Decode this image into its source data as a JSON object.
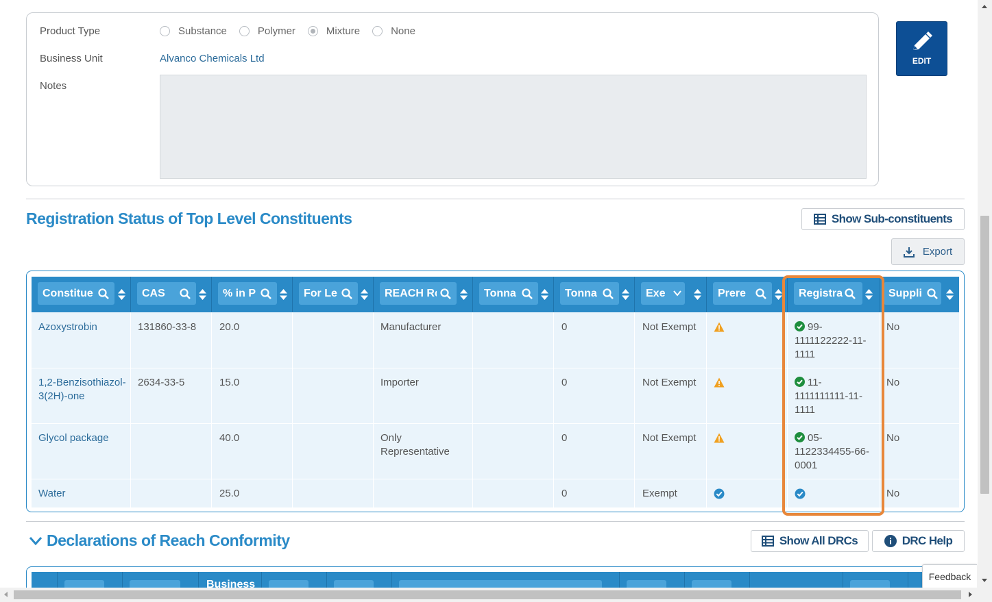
{
  "form": {
    "product_type_label": "Product Type",
    "product_type_options": [
      {
        "label": "Substance",
        "checked": false
      },
      {
        "label": "Polymer",
        "checked": false
      },
      {
        "label": "Mixture",
        "checked": true
      },
      {
        "label": "None",
        "checked": false
      }
    ],
    "business_unit_label": "Business Unit",
    "business_unit_value": "Alvanco Chemicals Ltd",
    "notes_label": "Notes",
    "notes_value": ""
  },
  "edit_button": {
    "label": "EDIT",
    "icon": "pencil-icon"
  },
  "registration_section": {
    "title": "Registration Status of Top Level Constituents",
    "show_sub_label": "Show Sub-constituents",
    "export_label": "Export"
  },
  "table": {
    "headers": [
      "Constitue",
      "CAS",
      "% in P",
      "For Le",
      "REACH Rc",
      "Tonna",
      "Tonna",
      "Exe",
      "Prere",
      "Registra",
      "Suppli"
    ],
    "rows": [
      {
        "constituent": "Azoxystrobin",
        "cas": "131860-33-8",
        "percent": "20.0",
        "for_legal": "",
        "reach_role": "Manufacturer",
        "tonnage1": "",
        "tonnage2": "0",
        "exemption": "Not Exempt",
        "prereg": "warning",
        "registration": "99-1111122222-11-1111",
        "registration_status": "ok",
        "supplier": "No"
      },
      {
        "constituent": "1,2-Benzisothiazol-3(2H)-one",
        "cas": "2634-33-5",
        "percent": "15.0",
        "for_legal": "",
        "reach_role": "Importer",
        "tonnage1": "",
        "tonnage2": "0",
        "exemption": "Not Exempt",
        "prereg": "warning",
        "registration": "11-1111111111-11-1111",
        "registration_status": "ok",
        "supplier": "No"
      },
      {
        "constituent": "Glycol package",
        "cas": "",
        "percent": "40.0",
        "for_legal": "",
        "reach_role": "Only Representative",
        "tonnage1": "",
        "tonnage2": "0",
        "exemption": "Not Exempt",
        "prereg": "warning",
        "registration": "05-1122334455-66-0001",
        "registration_status": "ok",
        "supplier": "No"
      },
      {
        "constituent": "Water",
        "cas": "",
        "percent": "25.0",
        "for_legal": "",
        "reach_role": "",
        "tonnage1": "",
        "tonnage2": "0",
        "exemption": "Exempt",
        "prereg": "check",
        "registration": "",
        "registration_status": "exempt-check",
        "supplier": "No"
      }
    ]
  },
  "drc_section": {
    "title": "Declarations of Reach Conformity",
    "show_all_label": "Show All DRCs",
    "help_label": "DRC Help",
    "partial_header": "Business"
  },
  "feedback_label": "Feedback",
  "colors": {
    "accent": "#2a8ac7",
    "highlight": "#e8873a",
    "warning": "#f0a020",
    "ok": "#1e8e3e"
  }
}
